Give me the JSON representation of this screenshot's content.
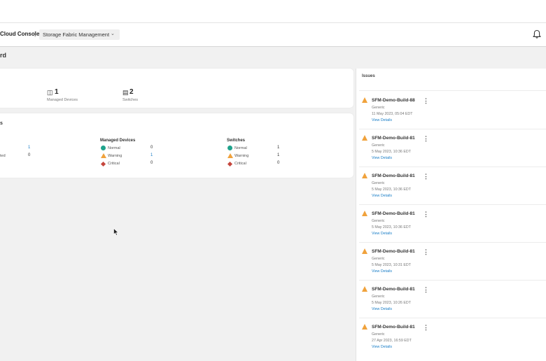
{
  "header": {
    "brand": "Cloud Console",
    "separator": "|",
    "app_selector": "Storage Fabric Management",
    "page_title": "rd"
  },
  "summary": {
    "managed_devices": {
      "count": "1",
      "label": "Managed Devices"
    },
    "switches": {
      "count": "2",
      "label": "Switches"
    }
  },
  "status": {
    "title": "s",
    "partial_rows": [
      {
        "label": "",
        "value": "1"
      },
      {
        "label": "ted",
        "value": "0"
      }
    ],
    "managed_devices": {
      "title": "Managed Devices",
      "rows": [
        {
          "label": "Normal",
          "value": "0"
        },
        {
          "label": "Warning",
          "value": "1"
        },
        {
          "label": "Critical",
          "value": "0"
        }
      ]
    },
    "switches": {
      "title": "Switches",
      "rows": [
        {
          "label": "Normal",
          "value": "1"
        },
        {
          "label": "Warning",
          "value": "1"
        },
        {
          "label": "Critical",
          "value": "0"
        }
      ]
    }
  },
  "issues": {
    "title": "Issues",
    "items": [
      {
        "title": "SFM-Demo-Build-88",
        "type": "Generic",
        "date": "11 May 2023, 05:04 EDT",
        "link": "View Details"
      },
      {
        "title": "SFM-Demo-Build-81",
        "type": "Generic",
        "date": "5 May 2023, 10:36 EDT",
        "link": "View Details"
      },
      {
        "title": "SFM-Demo-Build-81",
        "type": "Generic",
        "date": "5 May 2023, 10:36 EDT",
        "link": "View Details"
      },
      {
        "title": "SFM-Demo-Build-81",
        "type": "Generic",
        "date": "5 May 2023, 10:36 EDT",
        "link": "View Details"
      },
      {
        "title": "SFM-Demo-Build-81",
        "type": "Generic",
        "date": "5 May 2023, 10:31 EDT",
        "link": "View Details"
      },
      {
        "title": "SFM-Demo-Build-81",
        "type": "Generic",
        "date": "5 May 2023, 10:26 EDT",
        "link": "View Details"
      },
      {
        "title": "SFM-Demo-Build-81",
        "type": "Generic",
        "date": "27 Apr 2023, 16:59 EDT",
        "link": "View Details"
      }
    ]
  },
  "colors": {
    "normal": "#20a38c",
    "warning": "#f0a23c",
    "critical": "#c5463d",
    "link": "#1a7ec7"
  }
}
